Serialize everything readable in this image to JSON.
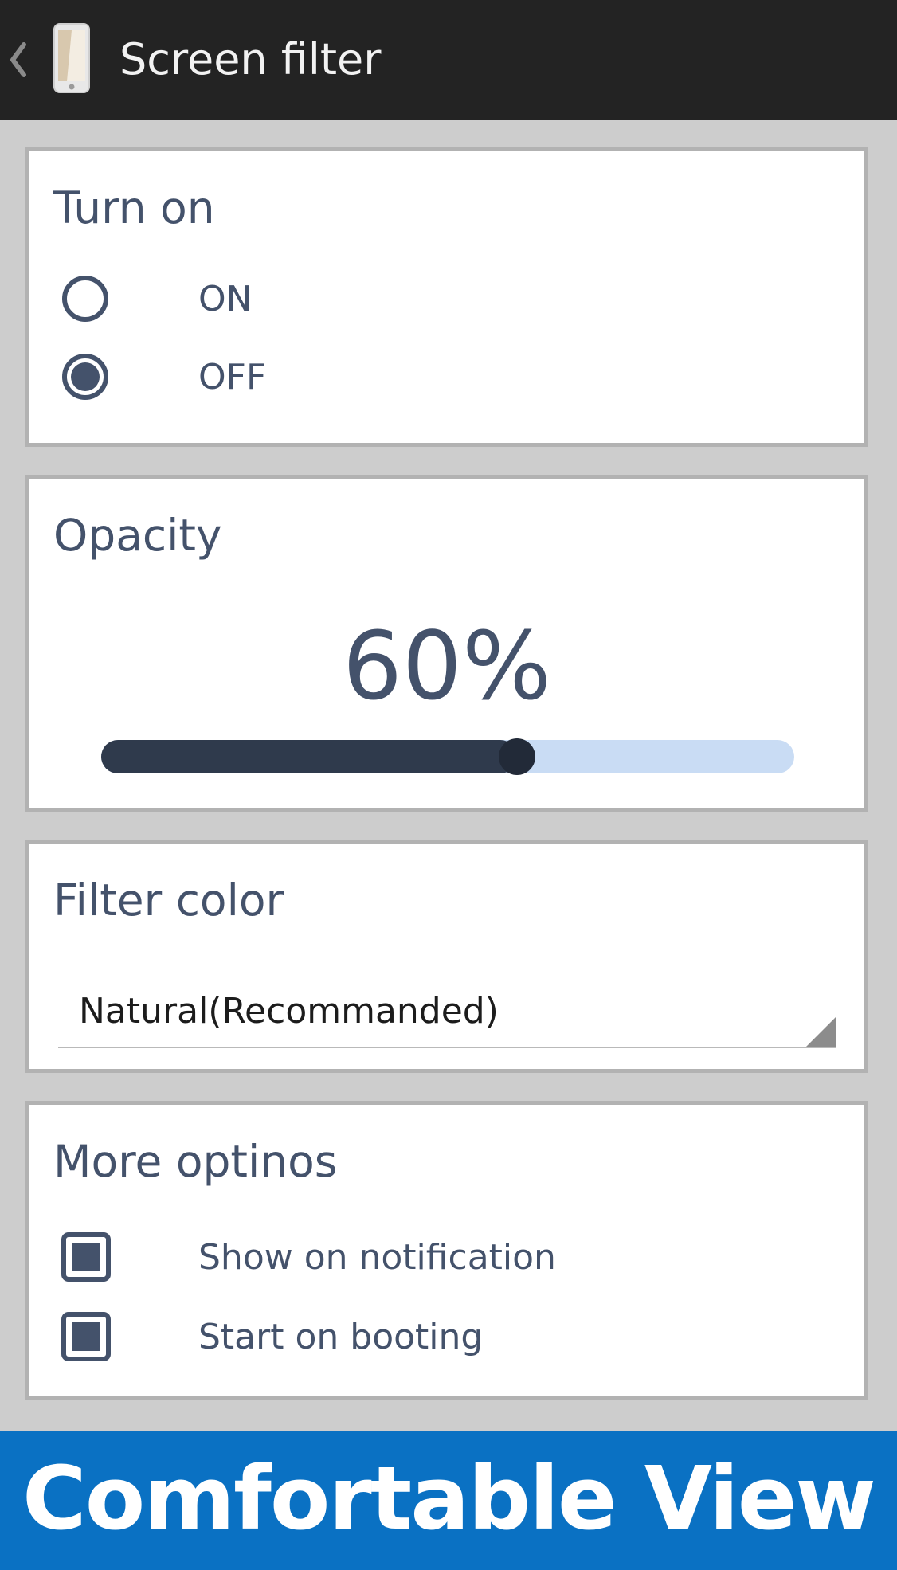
{
  "header": {
    "title": "Screen filter",
    "back_icon": "back-chevron-icon",
    "app_icon": "phone-filter-icon"
  },
  "turn_on": {
    "title": "Turn on",
    "options": [
      {
        "label": "ON",
        "selected": false
      },
      {
        "label": "OFF",
        "selected": true
      }
    ]
  },
  "opacity": {
    "title": "Opacity",
    "value_label": "60%",
    "value_fraction": 0.6
  },
  "filter_color": {
    "title": "Filter color",
    "selected": "Natural(Recommanded)"
  },
  "more_options": {
    "title": "More optinos",
    "options": [
      {
        "label": "Show on notification",
        "checked": true
      },
      {
        "label": "Start on booting",
        "checked": true
      }
    ]
  },
  "banner": {
    "text": "Comfortable View"
  },
  "colors": {
    "header_bg": "#232323",
    "page_bg": "#cdcdcd",
    "text": "#44526b",
    "slider_fill": "#2f3a4c",
    "slider_track": "#c9dcf4",
    "banner_bg": "#0a71c3"
  }
}
